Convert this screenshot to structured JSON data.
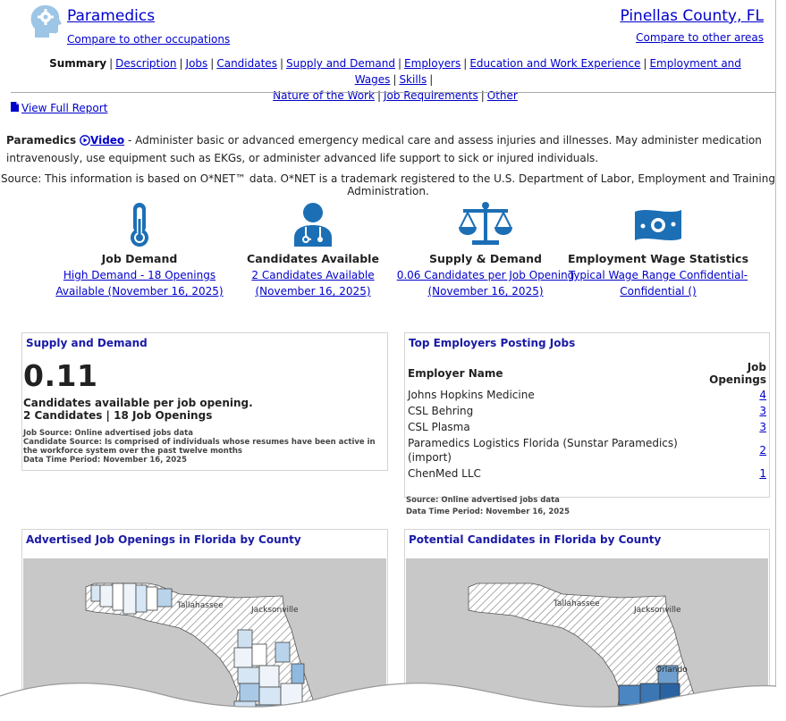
{
  "header": {
    "occupation": "Paramedics",
    "compare_occupations": "Compare to other occupations",
    "area": "Pinellas County, FL",
    "compare_areas": "Compare to other areas"
  },
  "nav": {
    "current": "Summary",
    "items": [
      "Description",
      "Jobs",
      "Candidates",
      "Supply and Demand",
      "Employers",
      "Education and Work Experience",
      "Employment and Wages",
      "Skills",
      "Nature of the Work",
      "Job Requirements",
      "Other"
    ]
  },
  "full_report": "View Full Report",
  "description": {
    "occupation": "Paramedics",
    "video": "Video",
    "text": " - Administer basic or advanced emergency medical care and assess injuries and illnesses. May administer medication intravenously, use equipment such as EKGs, or administer advanced life support to sick or injured individuals."
  },
  "source_line": "Source: This information is based on O*NET™ data. O*NET is a trademark registered to the U.S. Department of Labor, Employment and Training Administration.",
  "stats": [
    {
      "icon": "thermometer-icon",
      "title": "Job Demand",
      "line1": "High Demand - 18 Openings",
      "line2": "Available (November 16, 2025)"
    },
    {
      "icon": "doctor-icon",
      "title": "Candidates Available",
      "line1": "2 Candidates Available",
      "line2": "(November 16, 2025)"
    },
    {
      "icon": "scales-icon",
      "title": "Supply & Demand",
      "line1": "0.06 Candidates per Job Opening",
      "line2": "(November 16, 2025)"
    },
    {
      "icon": "money-icon",
      "title": "Employment Wage Statistics",
      "line1": "Typical Wage Range Confidential-",
      "line2": "Confidential ()"
    }
  ],
  "supply_panel": {
    "title": "Supply and Demand",
    "ratio": "0.11",
    "line1": "Candidates available per job opening.",
    "line2": "2 Candidates | 18 Job Openings",
    "src1": "Job Source: Online advertised jobs data",
    "src2": "Candidate Source: Is comprised of individuals whose resumes have been active in the workforce system over the past twelve months",
    "src3": "Data Time Period: November 16, 2025"
  },
  "employers_panel": {
    "title": "Top Employers Posting Jobs",
    "col_name": "Employer Name",
    "col_openings": "Job Openings",
    "rows": [
      {
        "name": "Johns Hopkins Medicine",
        "openings": "4"
      },
      {
        "name": "CSL Behring",
        "openings": "3"
      },
      {
        "name": "CSL Plasma",
        "openings": "3"
      },
      {
        "name": "Paramedics Logistics Florida (Sunstar Paramedics) (import)",
        "openings": "2"
      },
      {
        "name": "ChenMed LLC",
        "openings": "1"
      }
    ],
    "src1": "Source: Online advertised jobs data",
    "src2": "Data Time Period: November 16, 2025"
  },
  "map_left": {
    "title": "Advertised Job Openings in Florida by County",
    "labels": [
      "Tallahassee",
      "Jacksonville"
    ]
  },
  "map_right": {
    "title": "Potential Candidates in Florida by County",
    "labels": [
      "Tallahassee",
      "Jacksonville",
      "Orlando"
    ]
  },
  "colors": {
    "link": "#0000cc",
    "panel_title": "#1a1aa6",
    "icon": "#1c6fb5"
  }
}
